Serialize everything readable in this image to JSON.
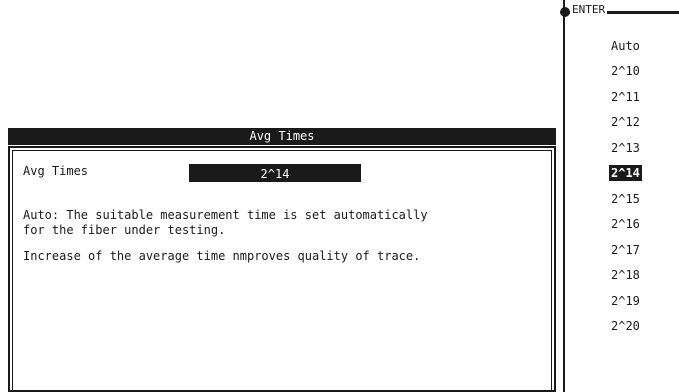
{
  "dialog": {
    "title": "Avg Times",
    "field_label": "Avg Times",
    "field_value": "2^14",
    "help_line1": "Auto: The suitable measurement time is set automatically",
    "help_line2": "for the fiber under testing.",
    "help_line3": "Increase of the average time nmproves quality of trace."
  },
  "side_list": {
    "header": "ENTER",
    "selected": "2^14",
    "options": [
      "Auto",
      "2^10",
      "2^11",
      "2^12",
      "2^13",
      "2^14",
      "2^15",
      "2^16",
      "2^17",
      "2^18",
      "2^19",
      "2^20"
    ]
  },
  "colors": {
    "foreground": "#1a1a1a",
    "background": "#ffffff"
  }
}
